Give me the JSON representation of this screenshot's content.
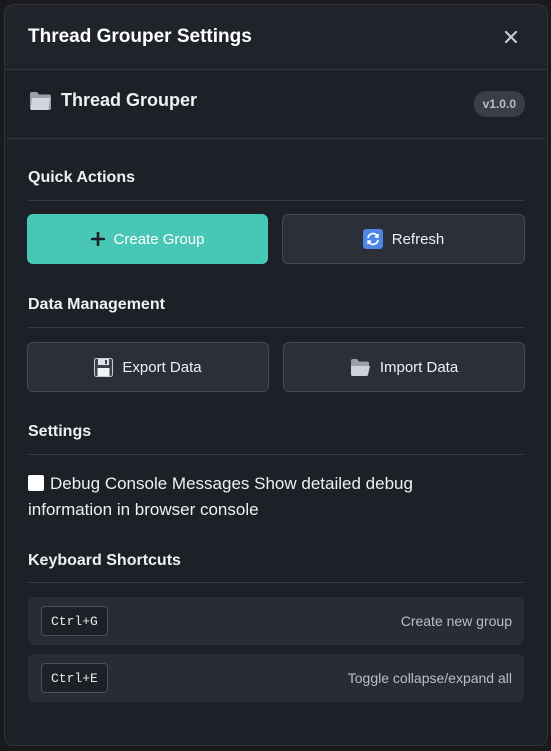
{
  "dialog": {
    "title": "Thread Grouper Settings"
  },
  "app": {
    "name": "Thread Grouper",
    "version": "v1.0.0",
    "icon": "folder-icon"
  },
  "sections": {
    "quick_actions": "Quick Actions",
    "data_management": "Data Management",
    "settings": "Settings",
    "keyboard_shortcuts": "Keyboard Shortcuts"
  },
  "buttons": {
    "create_group": "Create Group",
    "refresh": "Refresh",
    "export_data": "Export Data",
    "import_data": "Import Data"
  },
  "settings_items": {
    "debug_label": "Debug Console Messages",
    "debug_desc": "Show detailed debug information in browser console",
    "debug_checked": false
  },
  "shortcuts": [
    {
      "key": "Ctrl+G",
      "description": "Create new group"
    },
    {
      "key": "Ctrl+E",
      "description": "Toggle collapse/expand all"
    }
  ],
  "colors": {
    "accent": "#48c6b6",
    "background": "#202329",
    "panel": "#1d2026"
  }
}
